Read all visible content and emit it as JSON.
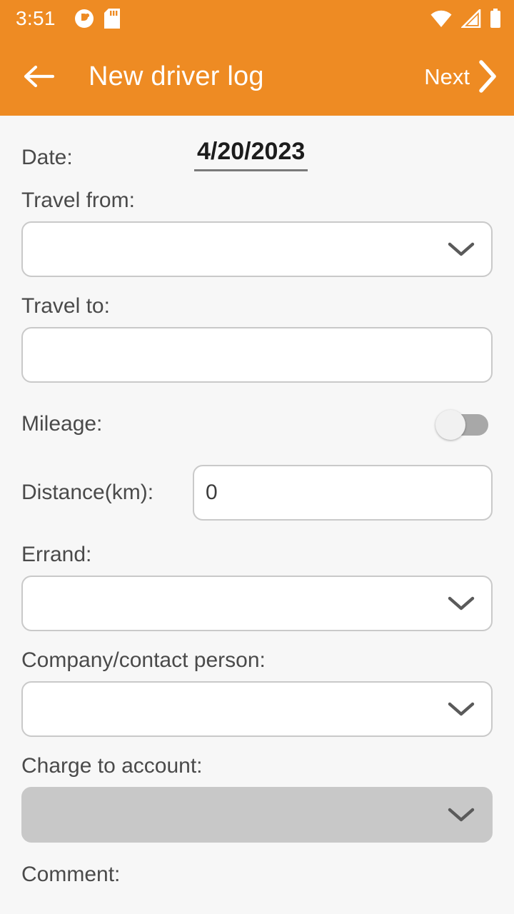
{
  "status_bar": {
    "time": "3:51",
    "left_icons": [
      "app-notification-icon",
      "sd-card-icon"
    ],
    "right_icons": [
      "wifi-icon",
      "cellular-signal-icon",
      "battery-icon"
    ]
  },
  "app_bar": {
    "back_icon": "back-arrow-icon",
    "title": "New driver log",
    "next_label": "Next",
    "next_icon": "chevron-right-icon",
    "background_color": "#ee8b23",
    "text_color": "#ffffff"
  },
  "form": {
    "date": {
      "label": "Date:",
      "value": "4/20/2023"
    },
    "travel_from": {
      "label": "Travel from:",
      "value": "",
      "type": "dropdown",
      "enabled": true
    },
    "travel_to": {
      "label": "Travel to:",
      "value": "",
      "type": "text",
      "enabled": true
    },
    "mileage": {
      "label": "Mileage:",
      "type": "toggle",
      "value": "off"
    },
    "distance": {
      "label": "Distance(km):",
      "value": "0",
      "type": "number"
    },
    "errand": {
      "label": "Errand:",
      "value": "",
      "type": "dropdown",
      "enabled": true
    },
    "company_contact": {
      "label": "Company/contact person:",
      "value": "",
      "type": "dropdown",
      "enabled": true
    },
    "charge_to_account": {
      "label": "Charge to account:",
      "value": "",
      "type": "dropdown",
      "enabled": false
    },
    "comment": {
      "label": "Comment:"
    }
  },
  "colors": {
    "accent": "#ee8b23",
    "background": "#f7f7f7",
    "field_border": "#c9c9c9",
    "disabled_fill": "#c8c8c8",
    "label_text": "#4a4a4a"
  }
}
